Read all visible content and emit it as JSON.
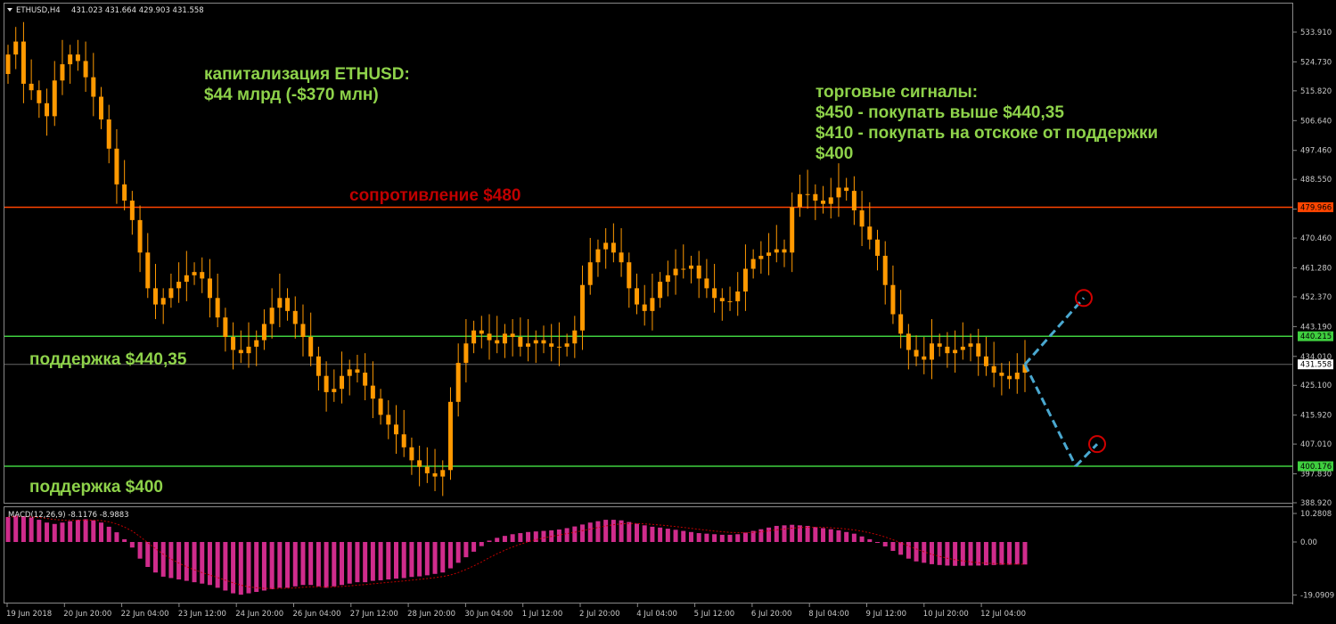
{
  "header": {
    "symbol_tf": "ETHUSD,H4",
    "ohlc": "431.023 431.664 429.903 431.558",
    "menu_icon": "triangle-down-icon"
  },
  "colors": {
    "background": "#000000",
    "candle": "#ff9900",
    "resistance": "#ff4500",
    "support": "#3fcf3f",
    "forecast": "#4aa8d0",
    "target_circle": "#d00000",
    "macd_hist": "#d02c8c",
    "macd_signal": "#c00000",
    "green_text": "#8ed24a",
    "red_text": "#c00000"
  },
  "annotations": {
    "cap_line1": "капитализация ETHUSD:",
    "cap_line2": "$44 млрд (-$370 млн)",
    "signals_line1": "торговые сигналы:",
    "signals_line2": "$450 - покупать выше $440,35",
    "signals_line3": "$410 - покупать на отскоке от поддержки",
    "signals_line4": "$400",
    "resistance_label": "сопротивление $480",
    "support1_label": "поддержка $440,35",
    "support2_label": "поддержка $400"
  },
  "levels": {
    "resistance": {
      "value": 479.966,
      "tag": "479.966"
    },
    "support1": {
      "value": 440.215,
      "tag": "440.215"
    },
    "support2": {
      "value": 400.176,
      "tag": "400.176"
    },
    "current": {
      "value": 431.558,
      "tag": "431.558"
    }
  },
  "macd": {
    "label": "MACD(12,26,9) -8.1176 -8.9883",
    "ticks": [
      "10.2808",
      "0.00",
      "-19.0909"
    ]
  },
  "chart_data": {
    "type": "candlestick",
    "symbol": "ETHUSD",
    "timeframe": "H4",
    "ylim": [
      388.92,
      538.5
    ],
    "price_ticks": [
      "533.910",
      "524.730",
      "515.820",
      "506.640",
      "497.460",
      "488.550",
      "479.370",
      "470.460",
      "461.280",
      "452.370",
      "443.190",
      "434.010",
      "425.100",
      "415.920",
      "407.010",
      "397.830",
      "388.920"
    ],
    "time_labels": [
      "19 Jun 2018",
      "20 Jun 20:00",
      "22 Jun 04:00",
      "23 Jun 12:00",
      "24 Jun 20:00",
      "26 Jun 04:00",
      "27 Jun 12:00",
      "28 Jun 20:00",
      "30 Jun 04:00",
      "1 Jul 12:00",
      "2 Jul 20:00",
      "4 Jul 04:00",
      "5 Jul 12:00",
      "6 Jul 20:00",
      "8 Jul 04:00",
      "9 Jul 12:00",
      "10 Jul 20:00",
      "12 Jul 04:00"
    ],
    "closes": [
      527,
      531,
      518,
      516,
      512,
      508,
      519,
      524,
      527,
      525,
      520,
      514,
      507,
      498,
      487,
      482,
      476,
      466,
      455,
      450,
      452,
      455,
      457,
      459,
      460,
      458,
      452,
      446,
      440,
      436,
      435,
      437,
      439,
      444,
      449,
      452,
      448,
      444,
      440,
      434,
      428,
      423,
      424,
      428,
      430,
      429,
      425,
      421,
      416,
      413,
      410,
      406,
      402,
      400,
      398,
      397,
      399,
      420,
      432,
      438,
      442,
      441,
      439,
      438,
      441,
      440,
      437,
      438,
      439,
      438,
      437,
      437,
      438,
      442,
      456,
      463,
      467,
      469,
      466,
      463,
      455,
      450,
      448,
      452,
      457,
      459,
      461,
      461,
      462,
      458,
      455,
      452,
      451,
      451,
      454,
      461,
      464,
      465,
      466,
      467,
      466,
      480,
      484,
      484,
      482,
      481,
      483,
      486,
      485,
      479,
      474,
      470,
      465,
      456,
      447,
      441,
      436,
      434,
      433,
      438,
      437,
      435,
      436,
      437,
      438,
      434,
      431,
      429,
      428,
      427,
      429,
      431.558
    ],
    "series": [
      {
        "name": "MACD(12,26,9)",
        "values": [
          9,
          9.5,
          9.2,
          8.8,
          8,
          7,
          6.5,
          7,
          7.5,
          8,
          8.2,
          7.8,
          7,
          5.5,
          3.5,
          1,
          -2,
          -6,
          -9,
          -11,
          -12.5,
          -13,
          -13.5,
          -14,
          -14.5,
          -15,
          -15.5,
          -16.5,
          -17.5,
          -18.5,
          -19,
          -18.5,
          -18,
          -17.5,
          -17,
          -16.5,
          -16.5,
          -16,
          -15.5,
          -15.5,
          -16,
          -16.5,
          -16,
          -15.5,
          -15,
          -14.5,
          -14.5,
          -14,
          -13.8,
          -13.5,
          -13.2,
          -13,
          -12.6,
          -12.4,
          -12,
          -11.5,
          -11,
          -9.5,
          -7.5,
          -5.5,
          -3.5,
          -1.5,
          0.5,
          1.5,
          2.2,
          2.8,
          3.2,
          3.6,
          3.8,
          4,
          4.2,
          4.5,
          5,
          5.6,
          6.3,
          7,
          7.5,
          8,
          8,
          7.8,
          7.2,
          6.6,
          6,
          5.5,
          5.2,
          4.8,
          4.4,
          4,
          3.6,
          3.2,
          3,
          2.8,
          2.6,
          2.6,
          2.8,
          3.4,
          4,
          4.6,
          5.2,
          5.8,
          6,
          6.2,
          6,
          5.8,
          5.4,
          5,
          4.6,
          4.2,
          3.6,
          3,
          2,
          1,
          0,
          -1.6,
          -3.2,
          -4.6,
          -6,
          -7,
          -7.5,
          -8,
          -8.3,
          -8.5,
          -8.6,
          -8.6,
          -8.5,
          -8.5,
          -8.4,
          -8.3,
          -8.2,
          -8.2,
          -8.1,
          -8.1176
        ]
      }
    ],
    "forecast": {
      "up_target": 452,
      "down_low": 400.2,
      "down_target": 407
    }
  }
}
